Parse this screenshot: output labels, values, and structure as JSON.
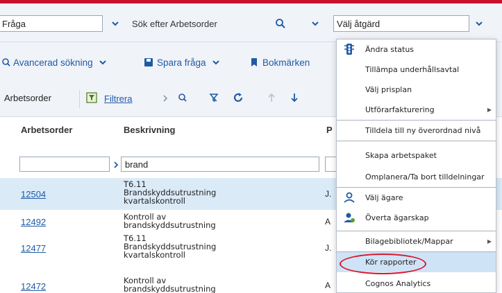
{
  "toolbar_top": {
    "query_value": "Fråga",
    "search_placeholder": "Sök efter Arbetsorder",
    "action_value": "Välj åtgärd"
  },
  "toolbar_links": {
    "advanced_search": "Avancerad sökning",
    "save_query": "Spara fråga",
    "bookmarks": "Bokmärken"
  },
  "list_toolbar": {
    "title": "Arbetsorder",
    "filter": "Filtrera"
  },
  "table": {
    "headers": [
      "Arbetsorder",
      "Beskrivning",
      "P"
    ],
    "filter_value": "brand",
    "rows": [
      {
        "id": "12504",
        "desc": "T6.11\nBrandskyddsutrustning\nkvartalskontroll",
        "p": "J."
      },
      {
        "id": "12492",
        "desc": "Kontroll av\nbrandskyddsutrustning",
        "p": "A"
      },
      {
        "id": "12477",
        "desc": "T6.11\nBrandskyddsutrustning\nkvartalskontroll",
        "p": "J."
      },
      {
        "id": "12472",
        "desc": "Kontroll av\nbrandskyddsutrustning",
        "p": "A"
      }
    ]
  },
  "menu": {
    "items": [
      "Ändra status",
      "Tillämpa underhållsavtal",
      "Välj prisplan",
      "Utförarfakturering",
      "Tilldela till ny överordnad nivå",
      "Skapa arbetspaket",
      "Omplanera/Ta bort tilldelningar",
      "Välj ägare",
      "Överta ägarskap",
      "Bilagebibliotek/Mappar",
      "Kör rapporter",
      "Cognos Analytics"
    ]
  },
  "colors": {
    "accent": "#1f5aa6",
    "brand_stripe": "#c8102e",
    "highlight": "#cfe3f7",
    "annotation": "#d9162a"
  }
}
